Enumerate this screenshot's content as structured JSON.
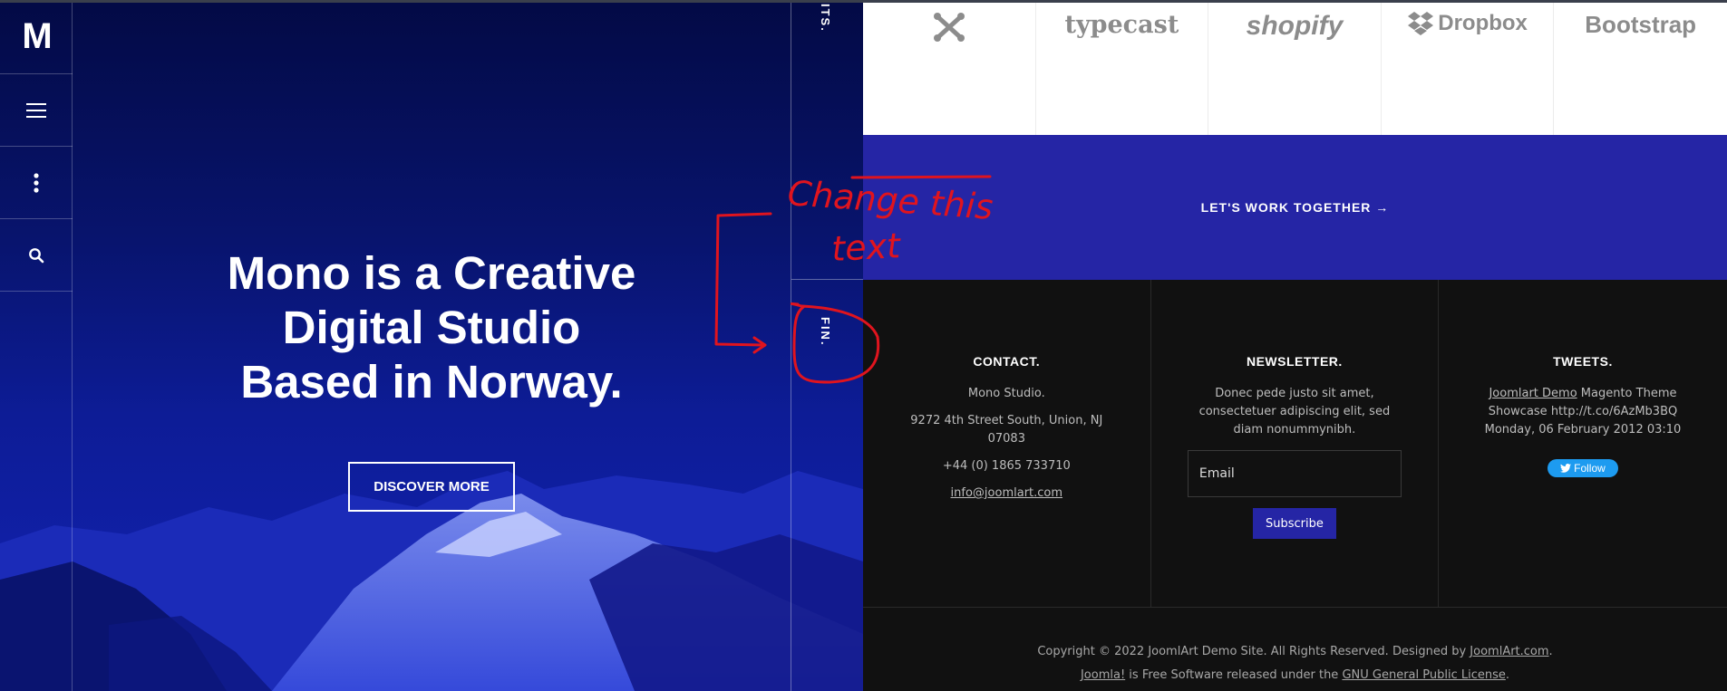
{
  "rail": {
    "logo": "M",
    "icons": [
      "hamburger-menu-icon",
      "vertical-dots-icon",
      "search-icon"
    ]
  },
  "hero": {
    "title_line1": "Mono is a Creative",
    "title_line2": "Digital Studio",
    "title_line3": "Based in Norway.",
    "cta_label": "DISCOVER MORE"
  },
  "strip": {
    "top_text": "ITS.",
    "fin_text": "FIN."
  },
  "logos": [
    "joomla-logo-icon",
    "typecast",
    "shopify",
    "Dropbox",
    "Bootstrap"
  ],
  "cta_band": {
    "label": "LET'S WORK TOGETHER →"
  },
  "footer": {
    "contact": {
      "title": "CONTACT.",
      "name": "Mono Studio.",
      "address": "9272 4th Street South, Union, NJ 07083",
      "phone": "+44 (0) 1865 733710",
      "email": "info@joomlart.com"
    },
    "newsletter": {
      "title": "NEWSLETTER.",
      "desc": "Donec pede justo sit amet, consectetuer adipiscing elit, sed diam nonummynibh.",
      "email_placeholder": "Email",
      "subscribe_label": "Subscribe"
    },
    "tweets": {
      "title": "TWEETS.",
      "link_text": "Joomlart Demo",
      "line1_rest": " Magento Theme",
      "line2": "Showcase http://t.co/6AzMb3BQ",
      "line3": "Monday, 06 February 2012 03:10",
      "follow_label": "Follow"
    },
    "copyright": {
      "line1_prefix": "Copyright © 2022 JoomlArt Demo Site. All Rights Reserved. Designed by ",
      "line1_link": "JoomlArt.com",
      "line1_suffix": ".",
      "line2_link1": "Joomla!",
      "line2_middle": " is Free Software released under the ",
      "line2_link2": "GNU General Public License",
      "line2_suffix": "."
    }
  },
  "annotation": {
    "text_line1": "Change this",
    "text_line2": "text",
    "color": "#e0141e"
  },
  "colors": {
    "accent": "#2525a5",
    "footer_bg": "#111111",
    "hero_bg": "#08146e"
  }
}
